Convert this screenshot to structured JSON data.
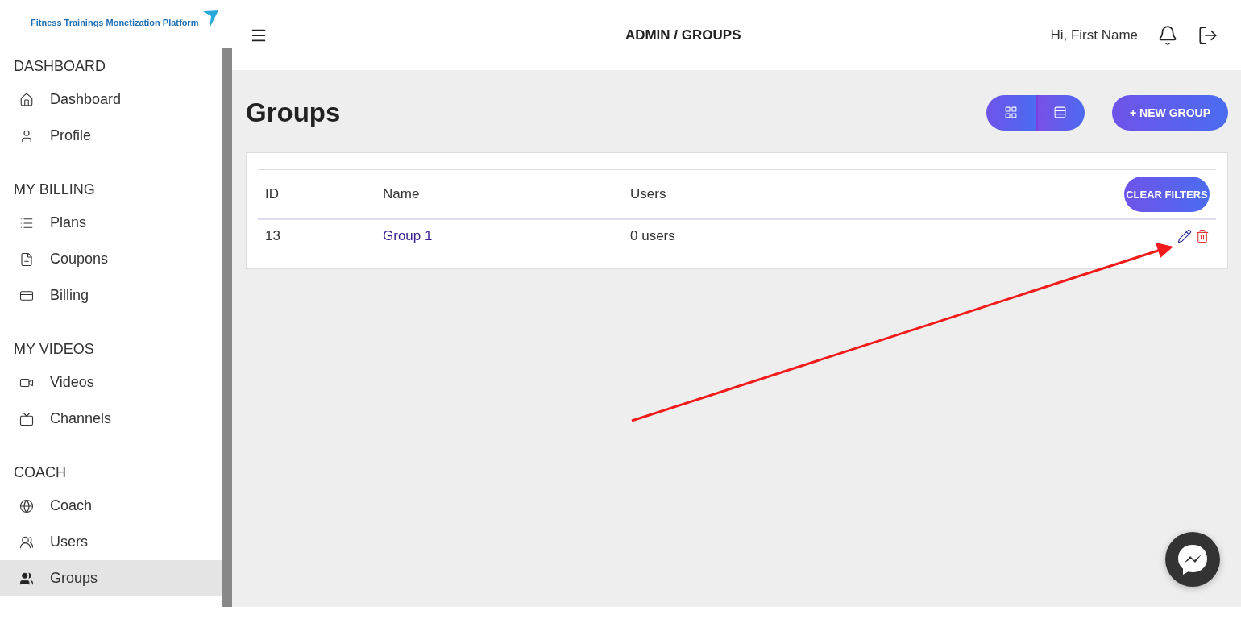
{
  "logo": {
    "text": "Fitness Trainings Monetization Platform"
  },
  "sidebar": {
    "sections": [
      {
        "title": "DASHBOARD",
        "items": [
          {
            "label": "Dashboard",
            "selected": false
          },
          {
            "label": "Profile",
            "selected": false
          }
        ]
      },
      {
        "title": "MY BILLING",
        "items": [
          {
            "label": "Plans",
            "selected": false
          },
          {
            "label": "Coupons",
            "selected": false
          },
          {
            "label": "Billing",
            "selected": false
          }
        ]
      },
      {
        "title": "MY VIDEOS",
        "items": [
          {
            "label": "Videos",
            "selected": false
          },
          {
            "label": "Channels",
            "selected": false
          }
        ]
      },
      {
        "title": "COACH",
        "items": [
          {
            "label": "Coach",
            "selected": false
          },
          {
            "label": "Users",
            "selected": false
          },
          {
            "label": "Groups",
            "selected": true
          }
        ]
      }
    ]
  },
  "header": {
    "title": "ADMIN / GROUPS",
    "greeting": "Hi, First Name"
  },
  "page": {
    "title": "Groups",
    "view_toggle": [
      {
        "kind": "grid",
        "selected": false
      },
      {
        "kind": "table",
        "selected": true
      }
    ],
    "new_button": "+ NEW GROUP"
  },
  "table": {
    "columns": [
      "ID",
      "Name",
      "Users"
    ],
    "clear_button": "CLEAR FILTERS",
    "rows": [
      {
        "id": "13",
        "name": "Group 1",
        "users": "0 users"
      }
    ]
  }
}
